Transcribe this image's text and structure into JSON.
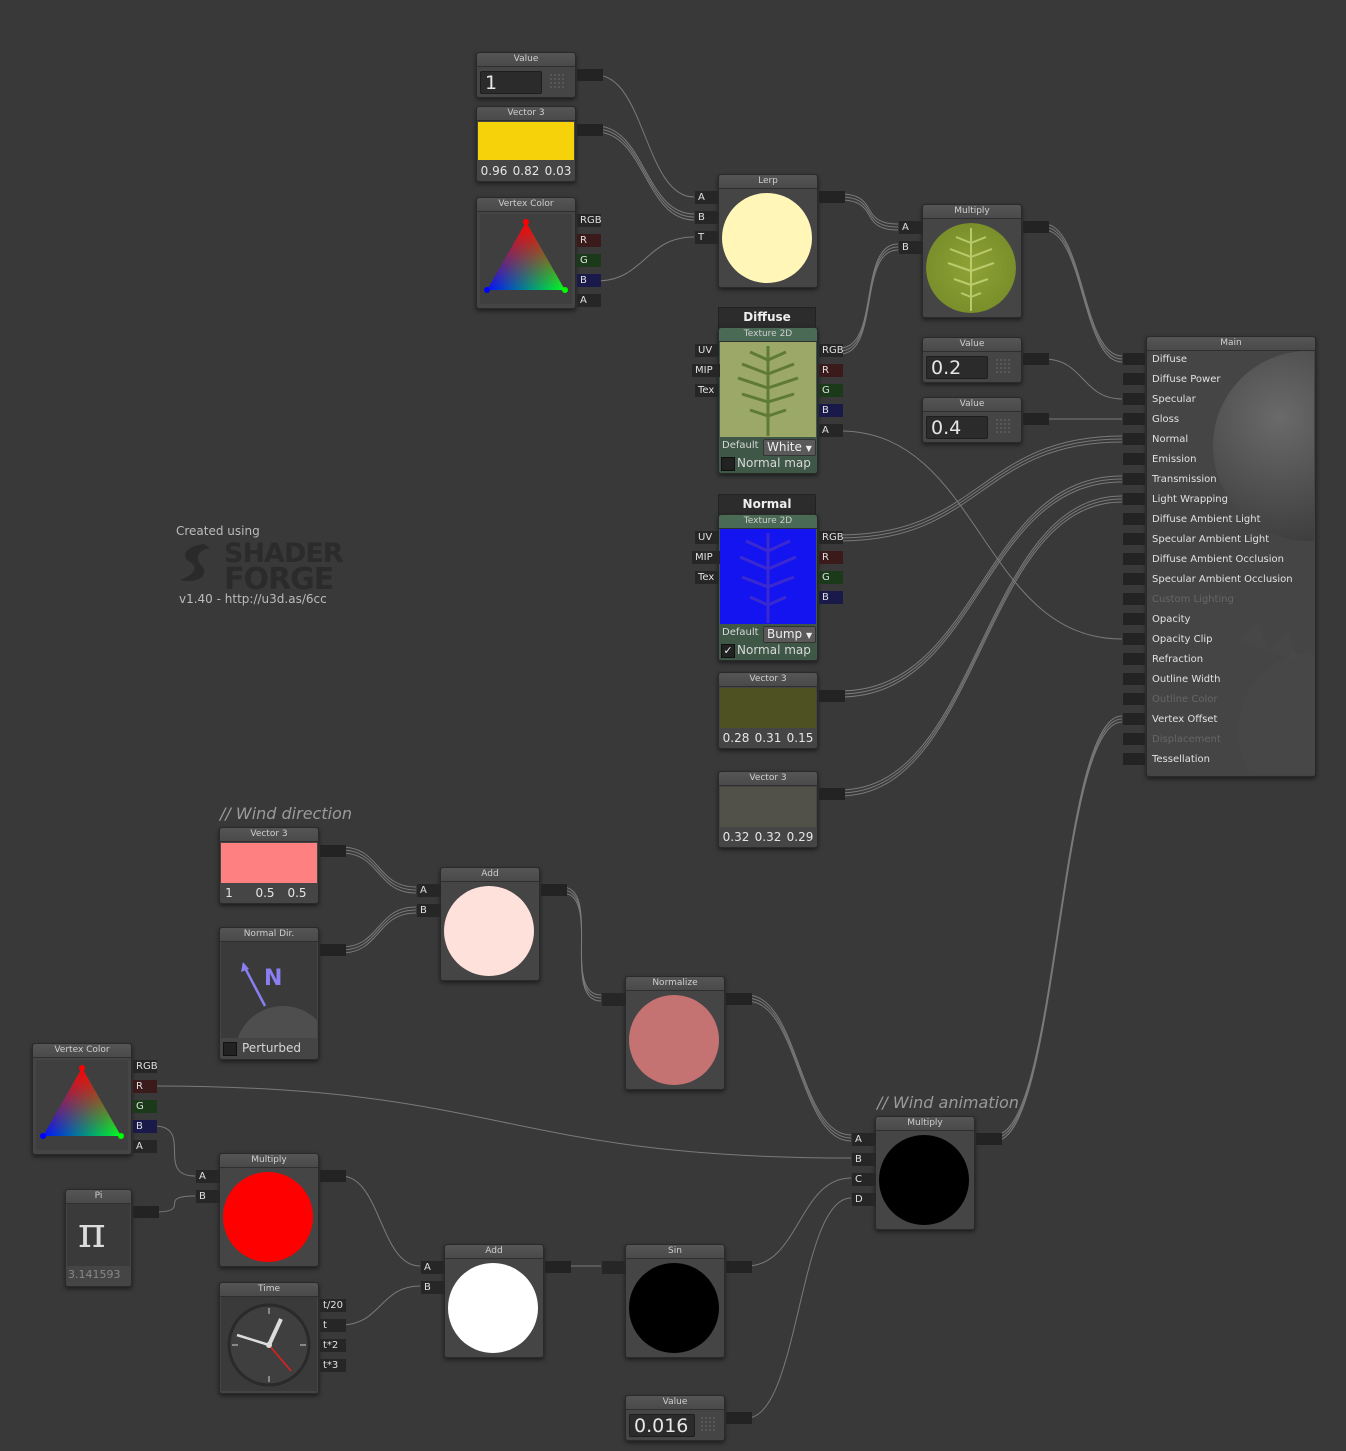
{
  "branding": {
    "created_using": "Created using",
    "product_line1": "SHADER",
    "product_line2": "FORGE",
    "version": "v1.40 - http://u3d.as/6cc"
  },
  "comments": {
    "wind_direction": "// Wind direction",
    "wind_animation": "// Wind animation"
  },
  "nodes": {
    "value1": {
      "title": "Value",
      "value": "1"
    },
    "vector3_yellow": {
      "title": "Vector 3",
      "x": "0.96",
      "y": "0.82",
      "z": "0.03",
      "color": "#f5d20a"
    },
    "vertexcolor_top": {
      "title": "Vertex Color",
      "outputs": [
        "RGB",
        "R",
        "G",
        "B",
        "A"
      ]
    },
    "lerp": {
      "title": "Lerp",
      "inputs": [
        "A",
        "B",
        "T"
      ],
      "preview_color": "#fff6b8"
    },
    "multiply_top": {
      "title": "Multiply",
      "inputs": [
        "A",
        "B"
      ]
    },
    "diffuse_tex": {
      "header": "Diffuse",
      "title": "Texture 2D",
      "inputs": [
        "UV",
        "MIP",
        "Tex"
      ],
      "outputs": [
        "RGB",
        "R",
        "G",
        "B",
        "A"
      ],
      "default_label": "Default",
      "default_value": "White",
      "normal_map_label": "Normal map",
      "normal_map_checked": false
    },
    "normal_tex": {
      "header": "Normal",
      "title": "Texture 2D",
      "inputs": [
        "UV",
        "MIP",
        "Tex"
      ],
      "outputs": [
        "RGB",
        "R",
        "G",
        "B"
      ],
      "default_label": "Default",
      "default_value": "Bump",
      "normal_map_label": "Normal map",
      "normal_map_checked": true
    },
    "value_02": {
      "title": "Value",
      "value": "0.2"
    },
    "value_04": {
      "title": "Value",
      "value": "0.4"
    },
    "vector3_olive": {
      "title": "Vector 3",
      "x": "0.28",
      "y": "0.31",
      "z": "0.15",
      "color": "#4e5222"
    },
    "vector3_gray": {
      "title": "Vector 3",
      "x": "0.32",
      "y": "0.32",
      "z": "0.29",
      "color": "#51514a"
    },
    "vector3_pink": {
      "title": "Vector 3",
      "x": "1",
      "y": "0.5",
      "z": "0.5",
      "color": "#ff8080"
    },
    "normal_dir": {
      "title": "Normal Dir.",
      "letter": "N",
      "perturbed_label": "Perturbed"
    },
    "add_top": {
      "title": "Add",
      "inputs": [
        "A",
        "B"
      ],
      "preview_color": "#ffe1db"
    },
    "normalize": {
      "title": "Normalize",
      "preview_color": "#c47272"
    },
    "vertexcolor_bottom": {
      "title": "Vertex Color",
      "outputs": [
        "RGB",
        "R",
        "G",
        "B",
        "A"
      ]
    },
    "multiply_red": {
      "title": "Multiply",
      "inputs": [
        "A",
        "B"
      ],
      "preview_color": "#ff0000"
    },
    "pi": {
      "title": "Pi",
      "symbol": "π",
      "value": "3.141593"
    },
    "time": {
      "title": "Time",
      "outputs": [
        "t/20",
        "t",
        "t*2",
        "t*3"
      ]
    },
    "add_bottom": {
      "title": "Add",
      "inputs": [
        "A",
        "B"
      ],
      "preview_color": "#ffffff"
    },
    "sin": {
      "title": "Sin",
      "preview_color": "#000000"
    },
    "multiply_wind": {
      "title": "Multiply",
      "inputs": [
        "A",
        "B",
        "C",
        "D"
      ],
      "preview_color": "#000000"
    },
    "value_0016": {
      "title": "Value",
      "value": "0.016"
    }
  },
  "main": {
    "title": "Main",
    "inputs": [
      {
        "label": "Diffuse",
        "enabled": true
      },
      {
        "label": "Diffuse Power",
        "enabled": true
      },
      {
        "label": "Specular",
        "enabled": true
      },
      {
        "label": "Gloss",
        "enabled": true
      },
      {
        "label": "Normal",
        "enabled": true
      },
      {
        "label": "Emission",
        "enabled": true
      },
      {
        "label": "Transmission",
        "enabled": true
      },
      {
        "label": "Light Wrapping",
        "enabled": true
      },
      {
        "label": "Diffuse Ambient Light",
        "enabled": true
      },
      {
        "label": "Specular Ambient Light",
        "enabled": true
      },
      {
        "label": "Diffuse Ambient Occlusion",
        "enabled": true
      },
      {
        "label": "Specular Ambient Occlusion",
        "enabled": true
      },
      {
        "label": "Custom Lighting",
        "enabled": false
      },
      {
        "label": "Opacity",
        "enabled": true
      },
      {
        "label": "Opacity Clip",
        "enabled": true
      },
      {
        "label": "Refraction",
        "enabled": true
      },
      {
        "label": "Outline Width",
        "enabled": true
      },
      {
        "label": "Outline Color",
        "enabled": false
      },
      {
        "label": "Vertex Offset",
        "enabled": true
      },
      {
        "label": "Displacement",
        "enabled": false
      },
      {
        "label": "Tessellation",
        "enabled": true
      }
    ]
  }
}
